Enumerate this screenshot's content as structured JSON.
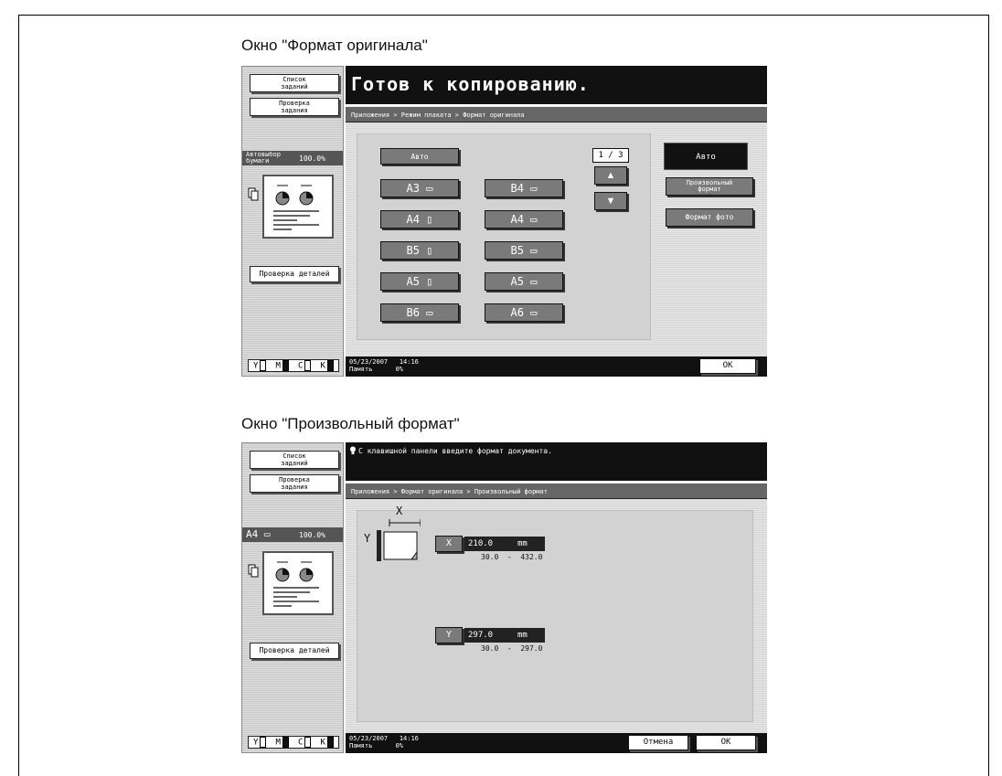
{
  "screens": [
    {
      "caption": "Окно \"Формат оригинала\"",
      "left": {
        "job_list": "Список\nзаданий",
        "job_check": "Проверка\nзадания",
        "paper_label": "Автовыбор\nбумаги",
        "zoom": "100.0%",
        "detail_check": "Проверка деталей"
      },
      "title": "Готов к копированию.",
      "breadcrumb": "Приложения > Режим плаката > Формат оригинала",
      "auto_btn": "Авто",
      "sizes": [
        [
          "A3 ▭",
          "B4 ▭"
        ],
        [
          "A4 ▯",
          "A4 ▭"
        ],
        [
          "B5 ▯",
          "B5 ▭"
        ],
        [
          "A5 ▯",
          "A5 ▭"
        ],
        [
          "B6 ▭",
          "A6 ▭"
        ]
      ],
      "page": "1 / 3",
      "right_auto": "Авто",
      "custom_size": "Произвольный\nформат",
      "photo_size": "Формат фото",
      "date": "05/23/2007",
      "time": "14:16",
      "memory_label": "Память",
      "memory_value": "0%",
      "ok": "OK"
    },
    {
      "caption": "Окно \"Произвольный формат\"",
      "left": {
        "job_list": "Список\nзаданий",
        "job_check": "Проверка\nзадания",
        "paper_label": "A4 ▭",
        "zoom": "100.0%",
        "detail_check": "Проверка деталей"
      },
      "message": "С клавишной панели введите формат документа.",
      "breadcrumb": "Приложения > Формат оригинала > Произвольный формат",
      "x_btn": "X",
      "x_value": "210.0",
      "x_unit": "mm",
      "x_range": "30.0  -  432.0",
      "y_btn": "Y",
      "y_value": "297.0",
      "y_unit": "mm",
      "y_range": "30.0  -  297.0",
      "diagram_x": "X",
      "diagram_y": "Y",
      "date": "05/23/2007",
      "time": "14:16",
      "memory_label": "Память",
      "memory_value": "0%",
      "cancel": "Отмена",
      "ok": "OK"
    }
  ],
  "ymck": [
    "Y",
    "M",
    "C",
    "K"
  ]
}
